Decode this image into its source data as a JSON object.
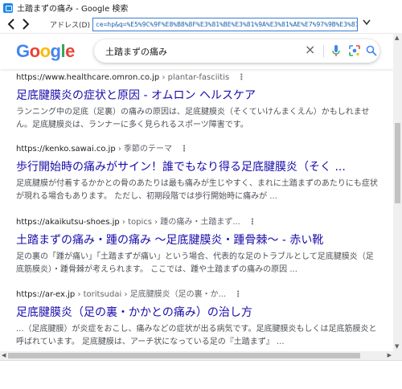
{
  "window": {
    "title": "土踏まずの痛み - Google 検索"
  },
  "navbar": {
    "address_label": "アドレス(D)",
    "url": "ce=hp&q=%E5%9C%9F%E8%B8%8F%E3%81%BE%E3%81%9A%E3%81%AE%E7%97%9B%E3%81%BF"
  },
  "search": {
    "query": "土踏まずの痛み"
  },
  "results": [
    {
      "site": "https://www.healthcare.omron.co.jp",
      "path": " › plantar-fasciitis",
      "title": "足底腱膜炎の症状と原因 - オムロン ヘルスケア",
      "snippet": "ランニング中の足底（足裏）の痛みの原因は、足底腱膜炎（そくていけんまくえん）かもしれません。足底腱膜炎は、ランナーに多く見られるスポーツ障害です。"
    },
    {
      "site": "https://kenko.sawai.co.jp",
      "path": " › 季節のテーマ",
      "title": "歩行開始時の痛みがサイン！誰でもなり得る足底腱膜炎（そく ...",
      "snippet": "足底腱膜が付着するかかとの骨のあたりは最も痛みが生じやすく、まれに土踏まずのあたりにも症状が現れる場合もあります。 ただし、初期段階では歩行開始時に痛みが ..."
    },
    {
      "site": "https://akaikutsu-shoes.jp",
      "path": " › topics › 踵の痛み・土踏まず...",
      "title": "土踏まずの痛み・踵の痛み ～足底腱膜炎・踵骨棘～ - 赤い靴",
      "snippet": "足の裏の「踵が痛い」「土踏まずが痛い」という場合、代表的な足のトラブルとして足底腱膜炎（足底筋膜炎）・踵骨棘が考えられます。 ここでは、踵や土踏まずの痛みの原因 ..."
    },
    {
      "site": "https://ar-ex.jp",
      "path": " › toritsudai › 足底腱膜炎（足の裏・か...",
      "title": "足底腱膜炎（足の裏・かかとの痛み）の治し方",
      "snippet": "...（足底腱膜）が炎症をおこし、痛みなどの症状が出る病気です。足底腱膜炎もしくは足底筋膜炎と呼ばれています。 足底腱膜は、アーチ状になっている足の『土踏まず』 ..."
    }
  ],
  "colors": {
    "link": "#1a0dab",
    "accent": "#1e88e5"
  }
}
